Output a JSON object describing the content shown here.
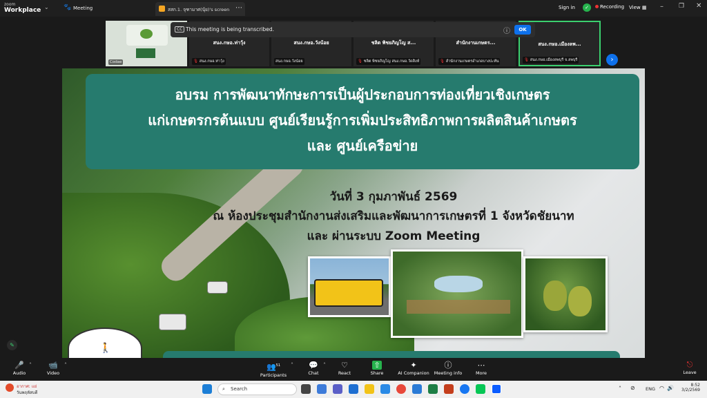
{
  "app": {
    "brand_line1": "zoom",
    "brand_line2": "Workplace",
    "meeting_label": "Meeting"
  },
  "topbar": {
    "share_tab_label": "สสก.1. จุฑามาศ(นุ้ย)'s screen",
    "signin_label": "Sign in",
    "recording_label": "Recording",
    "view_label": "View"
  },
  "transcript_banner": {
    "text": "This meeting is being transcribed.",
    "ok_label": "OK"
  },
  "thumbnails": [
    {
      "name": "",
      "footer": "Codae"
    },
    {
      "name": "สนง.กษอ.ท่าวุ้ง",
      "footer": "สนง.กษอ.ท่าวุ้ง"
    },
    {
      "name": "สนง.กษอ.วังน้อย",
      "footer": "สนง.กษอ.วังน้อย"
    },
    {
      "name": "ชลิต พิชยภิญโญ ส...",
      "footer": "ชลิต พิชยภิญโญ สนง.กษอ.วัดสิงห์"
    },
    {
      "name": "สำนักงานเกษตร...",
      "footer": "สำนักงานเกษตรอำเภอบางปะหัน"
    },
    {
      "name": "สนง.กษอ.เมืองลพ...",
      "footer": "สนง.กษอ.เมืองลพบุรี จ.ลพบุรี"
    }
  ],
  "slide": {
    "title_lines": [
      "อบรม การพัฒนาทักษะการเป็นผู้ประกอบการท่องเที่ยวเชิงเกษตร",
      "แก่เกษตรกรต้นแบบ ศูนย์เรียนรู้การเพิ่มประสิทธิภาพการผลิตสินค้าเกษตร",
      "และ ศูนย์เครือข่าย"
    ],
    "date_line": "วันที่ 3 กุมภาพันธ์ 2569",
    "venue_line": "ณ ห้องประชุมสำนักงานส่งเสริมและพัฒนาการเกษตรที่ 1 จังหวัดชัยนาท",
    "zoom_line": "และ ผ่านระบบ Zoom Meeting"
  },
  "controls": {
    "audio": "Audio",
    "video": "Video",
    "participants": "Participants",
    "participants_count": "51",
    "chat": "Chat",
    "react": "React",
    "share": "Share",
    "ai_companion": "AI Companion",
    "meeting_info": "Meeting info",
    "more": "More",
    "leave": "Leave"
  },
  "taskbar": {
    "weather_line1": "อากาศ: แย่",
    "weather_line2": "วันพฤหัสบดี",
    "search_placeholder": "Search",
    "lang": "ENG",
    "time": "8:52",
    "date": "3/2/2569"
  },
  "colors": {
    "accent": "#0e71eb",
    "slide_teal": "#267b6e",
    "recording": "#e33333"
  }
}
